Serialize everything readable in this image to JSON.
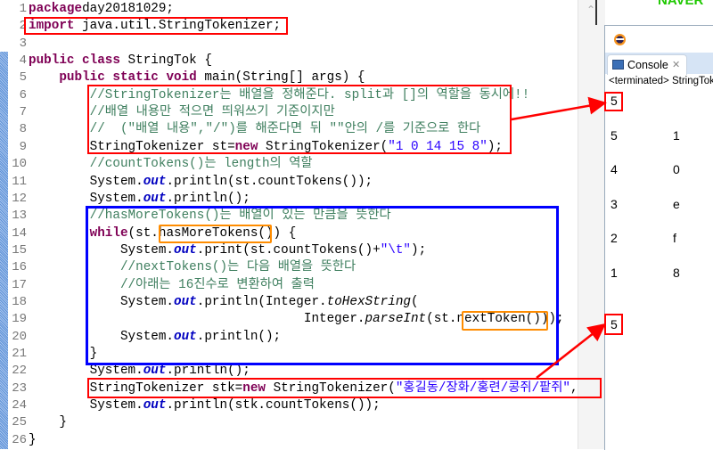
{
  "editor": {
    "lines": [
      [
        [
          "kw",
          "package"
        ],
        [
          "",
          "day20181029;"
        ]
      ],
      [
        [
          "kw",
          "import"
        ],
        [
          "",
          " java.util.StringTokenizer;"
        ]
      ],
      [],
      [
        [
          "kw",
          "public class"
        ],
        [
          "",
          " StringTok {"
        ]
      ],
      [
        [
          "",
          "    "
        ],
        [
          "kw",
          "public static void"
        ],
        [
          "",
          " main(String[] args) {"
        ]
      ],
      [
        [
          "",
          "        "
        ],
        [
          "cm",
          "//StringTokenizer는 배열을 정해준다. split과 []의 역할을 동시에!!"
        ]
      ],
      [
        [
          "",
          "        "
        ],
        [
          "cm",
          "//배열 내용만 적으면 띄워쓰기 기준이지만"
        ]
      ],
      [
        [
          "",
          "        "
        ],
        [
          "cm",
          "//  (\"배열 내용\",\"/\")를 해준다면 뒤 \"\"안의 /를 기준으로 한다"
        ]
      ],
      [
        [
          "",
          "        StringTokenizer st="
        ],
        [
          "kw",
          "new"
        ],
        [
          "",
          " StringTokenizer("
        ],
        [
          "st",
          "\"1 0 14 15 8\""
        ],
        [
          "",
          ");"
        ]
      ],
      [
        [
          "",
          "        "
        ],
        [
          "cm",
          "//countTokens()는 length의 역할"
        ]
      ],
      [
        [
          "",
          "        System."
        ],
        [
          "fld",
          "out"
        ],
        [
          "",
          ".println(st.countTokens());"
        ]
      ],
      [
        [
          "",
          "        System."
        ],
        [
          "fld",
          "out"
        ],
        [
          "",
          ".println();"
        ]
      ],
      [
        [
          "",
          "        "
        ],
        [
          "cm",
          "//hasMoreTokens()는 배열이 있는 만큼을 뜻한다"
        ]
      ],
      [
        [
          "",
          "        "
        ],
        [
          "kw",
          "while"
        ],
        [
          "",
          "(st.hasMoreTokens()) {"
        ]
      ],
      [
        [
          "",
          "            System."
        ],
        [
          "fld",
          "out"
        ],
        [
          "",
          ".print(st.countTokens()+"
        ],
        [
          "st",
          "\"\\t\""
        ],
        [
          "",
          ");"
        ]
      ],
      [
        [
          "",
          "            "
        ],
        [
          "cm",
          "//nextTokens()는 다음 배열을 뜻한다"
        ]
      ],
      [
        [
          "",
          "            "
        ],
        [
          "cm",
          "//아래는 16진수로 변환하여 출력"
        ]
      ],
      [
        [
          "",
          "            System."
        ],
        [
          "fld",
          "out"
        ],
        [
          "",
          ".println(Integer."
        ],
        [
          "it",
          "toHexString"
        ],
        [
          "",
          "("
        ]
      ],
      [
        [
          "",
          "                                    Integer."
        ],
        [
          "it",
          "parseInt"
        ],
        [
          "",
          "(st.nextToken()));"
        ]
      ],
      [
        [
          "",
          "            System."
        ],
        [
          "fld",
          "out"
        ],
        [
          "",
          ".println();"
        ]
      ],
      [
        [
          "",
          "        }"
        ]
      ],
      [
        [
          "",
          "        System."
        ],
        [
          "fld",
          "out"
        ],
        [
          "",
          ".println();"
        ]
      ],
      [
        [
          "",
          "        StringTokenizer stk="
        ],
        [
          "kw",
          "new"
        ],
        [
          "",
          " StringTokenizer("
        ],
        [
          "st",
          "\"홍길동/장화/홍련/콩쥐/팥쥐\""
        ],
        [
          "",
          ","
        ],
        [
          "st",
          "\"/\""
        ],
        [
          "",
          ")"
        ]
      ],
      [
        [
          "",
          "        System."
        ],
        [
          "fld",
          "out"
        ],
        [
          "",
          ".println(stk.countTokens());"
        ]
      ],
      [
        [
          "",
          "    }"
        ]
      ],
      [
        [
          "",
          "}"
        ]
      ]
    ]
  },
  "header": {
    "brand": "NAVER"
  },
  "console": {
    "tab_label": "Console",
    "close_glyph": "✕",
    "status": "<terminated> StringTok",
    "output": [
      "5",
      "",
      "5\t1",
      "",
      "4\t0",
      "",
      "3\te",
      "",
      "2\tf",
      "",
      "1\t8",
      "",
      "",
      "5"
    ]
  },
  "colors": {
    "highlight_red": "#ff0000",
    "highlight_blue": "#0000ff",
    "highlight_orange": "#ff8c00"
  }
}
